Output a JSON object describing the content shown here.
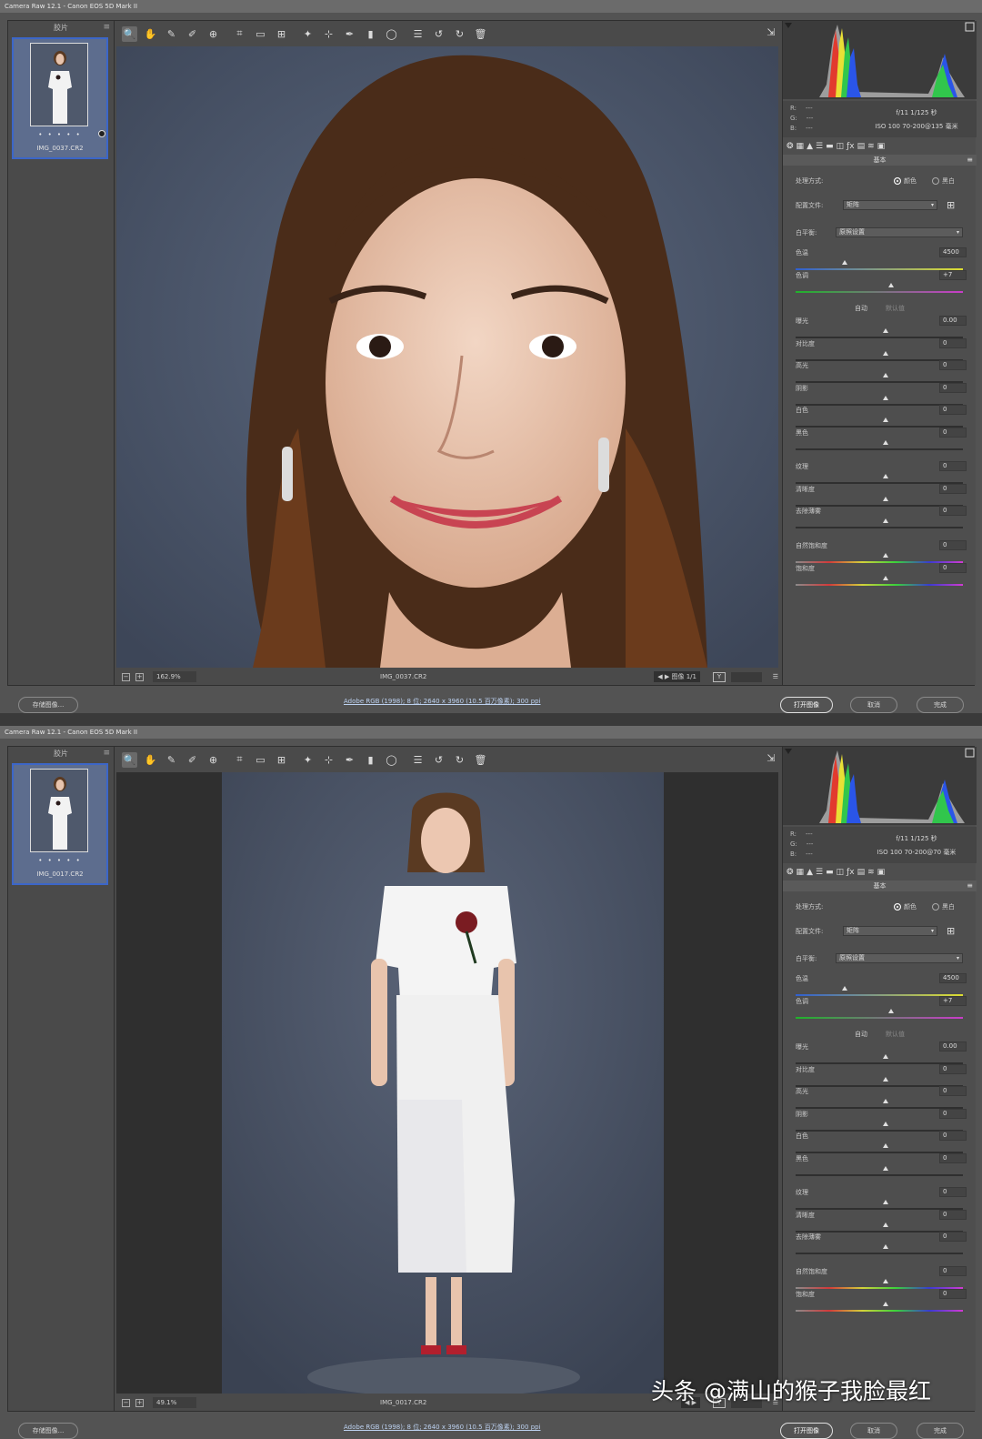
{
  "windows": [
    {
      "title": "Camera Raw 12.1 - Canon EOS 5D Mark II",
      "filmstrip_title": "胶片",
      "thumb_dots": "• • • • •",
      "thumb_name": "IMG_0037.CR2",
      "zoom": "162.9%",
      "status_filename": "IMG_0037.CR2",
      "image_counter": "图像 1/1",
      "rgb": [
        "R:",
        "G:",
        "B:"
      ],
      "rgb_values": [
        "---",
        "---",
        "---"
      ],
      "camera_line1": "f/11   1/125 秒",
      "camera_line2": "ISO 100   70-200@135 毫米",
      "panel_title": "基本",
      "treatment_label": "处理方式:",
      "treatment_color": "颜色",
      "treatment_bw": "黑白",
      "profile_label": "配置文件:",
      "profile_value": "矩阵",
      "wb_label": "白平衡:",
      "wb_value": "原照设置",
      "temp_label": "色温",
      "temp_value": "4500",
      "tint_label": "色调",
      "tint_value": "+7",
      "auto_label": "自动",
      "default_label": "默认值",
      "sliders_tone": [
        {
          "label": "曝光",
          "value": "0.00"
        },
        {
          "label": "对比度",
          "value": "0"
        },
        {
          "label": "高光",
          "value": "0"
        },
        {
          "label": "阴影",
          "value": "0"
        },
        {
          "label": "白色",
          "value": "0"
        },
        {
          "label": "黑色",
          "value": "0"
        }
      ],
      "sliders_presence": [
        {
          "label": "纹理",
          "value": "0"
        },
        {
          "label": "清晰度",
          "value": "0"
        },
        {
          "label": "去除薄雾",
          "value": "0"
        }
      ],
      "sliders_sat": [
        {
          "label": "自然饱和度",
          "value": "0"
        },
        {
          "label": "饱和度",
          "value": "0"
        }
      ],
      "save_button": "存储图像...",
      "file_info": "Adobe RGB (1998); 8 位; 2640 x 3960 (10.5 百万像素); 300 ppi",
      "open_button": "打开图像",
      "cancel_button": "取消",
      "done_button": "完成"
    },
    {
      "title": "Camera Raw 12.1 - Canon EOS 5D Mark II",
      "filmstrip_title": "胶片",
      "thumb_dots": "• • • • •",
      "thumb_name": "IMG_0017.CR2",
      "zoom": "49.1%",
      "status_filename": "IMG_0017.CR2",
      "image_counter": "",
      "rgb": [
        "R:",
        "G:",
        "B:"
      ],
      "rgb_values": [
        "---",
        "---",
        "---"
      ],
      "camera_line1": "f/11   1/125 秒",
      "camera_line2": "ISO 100   70-200@70 毫米",
      "panel_title": "基本",
      "treatment_label": "处理方式:",
      "treatment_color": "颜色",
      "treatment_bw": "黑白",
      "profile_label": "配置文件:",
      "profile_value": "矩阵",
      "wb_label": "白平衡:",
      "wb_value": "原照设置",
      "temp_label": "色温",
      "temp_value": "4500",
      "tint_label": "色调",
      "tint_value": "+7",
      "auto_label": "自动",
      "default_label": "默认值",
      "sliders_tone": [
        {
          "label": "曝光",
          "value": "0.00"
        },
        {
          "label": "对比度",
          "value": "0"
        },
        {
          "label": "高光",
          "value": "0"
        },
        {
          "label": "阴影",
          "value": "0"
        },
        {
          "label": "白色",
          "value": "0"
        },
        {
          "label": "黑色",
          "value": "0"
        }
      ],
      "sliders_presence": [
        {
          "label": "纹理",
          "value": "0"
        },
        {
          "label": "清晰度",
          "value": "0"
        },
        {
          "label": "去除薄雾",
          "value": "0"
        }
      ],
      "sliders_sat": [
        {
          "label": "自然饱和度",
          "value": "0"
        },
        {
          "label": "饱和度",
          "value": "0"
        }
      ],
      "save_button": "存储图像...",
      "file_info": "Adobe RGB (1998); 8 位; 2640 x 3960 (10.5 百万像素); 300 ppi",
      "open_button": "打开图像",
      "cancel_button": "取消",
      "done_button": "完成"
    }
  ],
  "watermark": "头条 @满山的猴子我脸最红",
  "colors": {
    "accent": "#3c66c8",
    "panel": "#4e4e4e",
    "backdrop": "#4a5568"
  }
}
